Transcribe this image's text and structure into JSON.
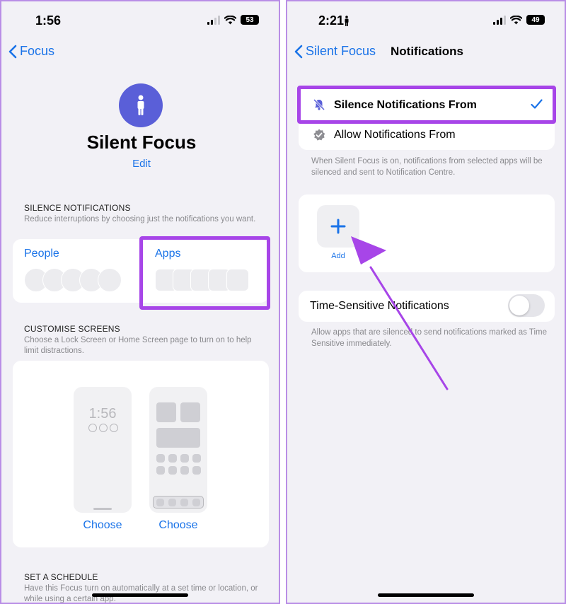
{
  "left": {
    "status": {
      "time": "1:56",
      "battery": "53"
    },
    "nav": {
      "back_label": "Focus"
    },
    "focus": {
      "title": "Silent Focus",
      "edit_label": "Edit"
    },
    "silence": {
      "header": "SILENCE NOTIFICATIONS",
      "description": "Reduce interruptions by choosing just the notifications you want.",
      "people_label": "People",
      "apps_label": "Apps"
    },
    "customise": {
      "header": "CUSTOMISE SCREENS",
      "description": "Choose a Lock Screen or Home Screen page to turn on to help limit distractions.",
      "lock_time": "1:56",
      "choose_lock_label": "Choose",
      "choose_home_label": "Choose"
    },
    "schedule": {
      "header": "SET A SCHEDULE",
      "description": "Have this Focus turn on automatically at a set time or location, or while using a certain app."
    }
  },
  "right": {
    "status": {
      "time": "2:21",
      "battery": "49"
    },
    "nav": {
      "back_label": "Silent Focus",
      "title": "Notifications"
    },
    "options": {
      "silence_label": "Silence Notifications From",
      "allow_label": "Allow Notifications From"
    },
    "options_note": "When Silent Focus is on, notifications from selected apps will be silenced and sent to Notification Centre.",
    "add_label": "Add",
    "time_sensitive": {
      "label": "Time-Sensitive Notifications",
      "enabled": false,
      "note": "Allow apps that are silenced to send notifications marked as Time Sensitive immediately."
    }
  },
  "colors": {
    "accent_blue": "#1a73e8",
    "highlight_purple": "#a745e8",
    "focus_icon_bg": "#5a5fd8",
    "background": "#f2f1f6"
  },
  "icons": [
    "signal-icon",
    "wifi-icon",
    "battery-icon",
    "chevron-left-icon",
    "person-icon",
    "bell-slash-icon",
    "checkmark-icon",
    "badge-check-icon",
    "plus-icon",
    "arrow-icon"
  ]
}
